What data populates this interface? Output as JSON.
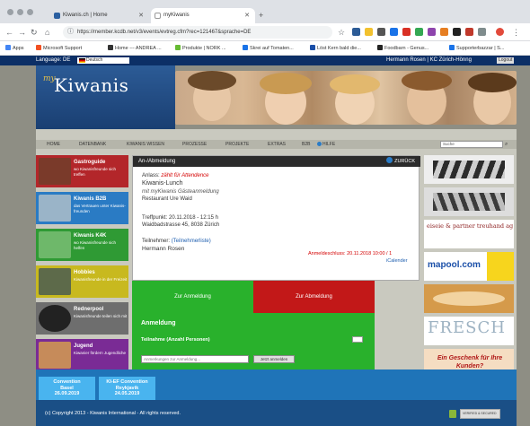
{
  "browser": {
    "tabs": [
      {
        "title": "Kiwanis.ch | Home"
      },
      {
        "title": "myKiwanis"
      }
    ],
    "url": "https://member.kcdb.net/v3/events/evtreg.cfm?rec=121467&sprache=DE",
    "bookmarks": [
      "Apps",
      "Microsoft Support",
      "Home --- ANDREA ...",
      "Produkte | NORK ...",
      "Skrei auf Tomaten...",
      "Löst Kern bald die...",
      "Foodbarn - Genus...",
      "Supporterbazzar | S..."
    ]
  },
  "site": {
    "language_label": "Language: DE",
    "language_value": "Deutsch",
    "user": "Hermann Rosen | KC Zürich-Hönng",
    "logout": "Logout",
    "logo_my": "my",
    "logo_word": "Kiwanis",
    "menu": [
      "HOME",
      "DATENBANK",
      "KIWANIS WISSEN",
      "PROZESSE",
      "PROJEKTE",
      "EXTRAS",
      "B2B",
      "HILFE"
    ],
    "search_placeholder": "Suche"
  },
  "left_tiles": [
    {
      "title": "Gastroguide",
      "sub": "wo Kiwanisfreunde sich treffen",
      "color": "#b3262a",
      "pic": "#7a3a2a"
    },
    {
      "title": "Kiwanis B2B",
      "sub": "das Vertrauen unter Kiwanis-freunden",
      "color": "#2a7bc4",
      "pic": "#9ab4c8"
    },
    {
      "title": "Kiwanis K4K",
      "sub": "wo Kiwanisfreunde sich helfen",
      "color": "#2f9a34",
      "pic": "#6eb86a"
    },
    {
      "title": "Hobbies",
      "sub": "Kiwanisfreunde in der Freizeit",
      "color": "#c8b91f",
      "pic": "#5d6a4a"
    },
    {
      "title": "Rednerpool",
      "sub": "Kiwanisfreunde teilen sich mit",
      "color": "#6e6e6e",
      "pic": "#222222"
    },
    {
      "title": "Jugend",
      "sub": "Kiwanier fördern Jugendliche",
      "color": "#7a2b95",
      "pic": "#c68b5a"
    }
  ],
  "event": {
    "header": "An-/Abmeldung",
    "back": "ZURÜCK",
    "anlass_label": "Anlass:",
    "anlass_value": "zählt für Attendence",
    "name": "Kiwanis-Lunch",
    "note": "mit myKiwanis Gästeanmeldung",
    "venue": "Restaurant Ure Waid",
    "treffpunkt": "Treffpunkt: 20.11.2018 - 12:15 h",
    "address": "Waidbadstrasse 45, 8038 Zürich",
    "teilnehmer_label": "Teilnehmer:",
    "teilnehmer_link": "(Teilnehmerliste)",
    "person": "Hermann Rosen",
    "schluss": "Anmeldeschluss: 20.11.2018 10:00 / 1",
    "ical": "iCalender"
  },
  "actions": {
    "anmelden": "Zur Anmeldung",
    "abmelden": "Zur Abmeldung",
    "heading": "Anmeldung",
    "participants_label": "Teilnahme (Anzahl Personen)",
    "comment_placeholder": "Anmerkungen zur Anmeldung...",
    "submit": "Jetzt anmelden"
  },
  "right_ads": [
    {
      "text": "",
      "bg": "#eeeeee",
      "color": "#333333"
    },
    {
      "text": "",
      "bg": "#dddddd",
      "color": "#333333"
    },
    {
      "text": "eiseie & partner treuhand ag",
      "bg": "#ffffff",
      "color": "#8a1a1a"
    },
    {
      "text": "mapool.com",
      "bg": "#ffffff",
      "color": "#1a4fa8"
    },
    {
      "text": "",
      "bg": "#d59a4a",
      "color": "#ffffff"
    },
    {
      "text": "FRESCH",
      "bg": "#ffffff",
      "color": "#8aa0b0"
    },
    {
      "text": "Ein Geschenk für Ihre Kunden?",
      "bg": "#f5ddc2",
      "color": "#b01818"
    }
  ],
  "conventions": [
    {
      "line1": "Convention",
      "line2": "Basel",
      "line3": "26.09.2019"
    },
    {
      "line1": "KI-EF Convention",
      "line2": "Reykjavik",
      "line3": "24.05.2019"
    }
  ],
  "footer": {
    "copyright": "(c) Copyright 2013 - Kiwanis International - All rights reserved.",
    "secure": "VERIFIED & SECURED"
  }
}
